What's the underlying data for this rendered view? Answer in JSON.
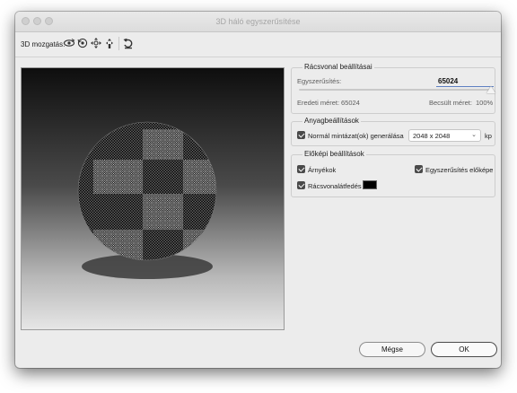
{
  "window": {
    "title": "3D háló egyszerűsítése"
  },
  "toolbar": {
    "label": "3D mozgatás:",
    "tools": [
      "orbit-icon",
      "roll-icon",
      "pan-icon",
      "slide-icon",
      "reset-icon"
    ]
  },
  "mesh": {
    "title": "Rácsvonal beállításai",
    "simplify_label": "Egyszerűsítés:",
    "simplify_value": "65024",
    "slider_level_percent": 100,
    "original_label": "Eredeti méret:",
    "original_value": "65024",
    "estimate_label": "Becsült méret:",
    "estimate_value": "100%"
  },
  "material": {
    "title": "Anyagbeállítások",
    "normal_map_label": "Normál mintázat(ok) generálása",
    "normal_map_checked": true,
    "resolution_value": "2048 x 2048",
    "unit": "kp"
  },
  "preview": {
    "title": "Előképi beállítások",
    "shadows_label": "Árnyékok",
    "simplify_preview_label": "Egyszerűsítés előképe",
    "wireframe_label": "Rácsvonalátfedés",
    "wireframe_color": "#000000"
  },
  "buttons": {
    "cancel": "Mégse",
    "ok": "OK"
  }
}
